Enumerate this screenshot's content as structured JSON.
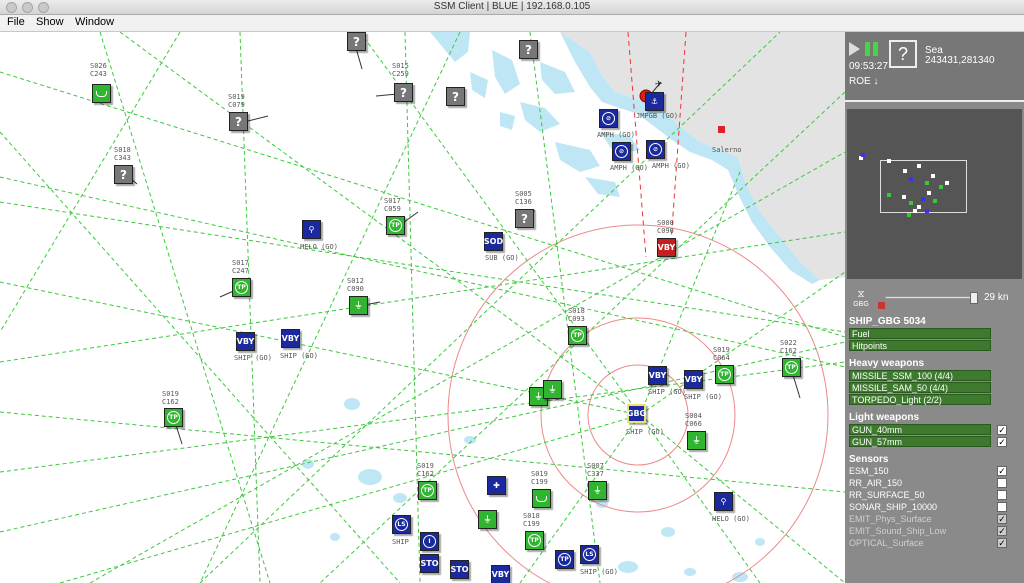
{
  "window": {
    "title": "SSM Client | BLUE | 192.168.0.105"
  },
  "menu": [
    "File",
    "Show",
    "Window"
  ],
  "hud": {
    "time": "09:53:27",
    "zone": "Sea",
    "coords": "243431,281340",
    "roe": "ROE ↓",
    "unknown_glyph": "?"
  },
  "speed": {
    "unit_glyph": "GBG",
    "value": "29 kn",
    "fraction": 0.93
  },
  "ship": {
    "name": "SHIP_GBG 5034",
    "bars": [
      "Fuel",
      "Hitpoints"
    ],
    "heavy_title": "Heavy weapons",
    "heavy": [
      "MISSILE_SSM_100 (4/4)",
      "MISSILE_SAM_50 (4/4)",
      "TORPEDO_Light (2/2)"
    ],
    "light_title": "Light weapons",
    "light": [
      {
        "name": "GUN_40mm",
        "checked": true
      },
      {
        "name": "GUN_57mm",
        "checked": true
      }
    ],
    "sensors_title": "Sensors",
    "sensors": [
      {
        "name": "ESM_150",
        "checked": true,
        "dim": false
      },
      {
        "name": "RR_AIR_150",
        "checked": false,
        "dim": false
      },
      {
        "name": "RR_SURFACE_50",
        "checked": false,
        "dim": false
      },
      {
        "name": "SONAR_SHIP_10000",
        "checked": false,
        "dim": false
      },
      {
        "name": "EMIT_Phys_Surface",
        "checked": true,
        "dim": true
      },
      {
        "name": "EMIT_Sound_Ship_Low",
        "checked": true,
        "dim": true
      },
      {
        "name": "OPTICAL_Surface",
        "checked": true,
        "dim": true
      }
    ]
  },
  "map_labels": {
    "salerno": "Salerno",
    "jmpgb": "JMPGB (GO)",
    "amph1": "AMPH (GO)",
    "amph2": "AMPH (GO)",
    "amph3": "AMPH (GO)",
    "helo1": "HELO (GO)",
    "helo2": "HELO (GO)",
    "sub": "SUB (GO)",
    "ship1": "SHIP (GO)",
    "ship2": "SHIP (GO)",
    "ship3": "SHIP (GO)",
    "ship4": "SHIP (GO)",
    "ship5": "SHIP (GO)",
    "ship6": "SHIP",
    "ship7": "SHIP (GO)",
    "s026": "S026\nC243",
    "s015": "S015\nC259",
    "s019a": "S019\nC079",
    "s018": "S018\nC343",
    "s017a": "S017\nC059",
    "s005": "S005\nC136",
    "s017b": "S017\nC247",
    "s012": "S012\nC090",
    "s019b": "S019\nC162",
    "s022": "S022\nC162",
    "s019c": "S019\nC064",
    "s004": "S004\nC066",
    "s000": "S000\nC090",
    "s018b": "S018\nC093",
    "s019d": "S019\nC162",
    "s007": "S007\nC337",
    "s018c": "S018\nC199",
    "s019e": "S019\nC199"
  }
}
